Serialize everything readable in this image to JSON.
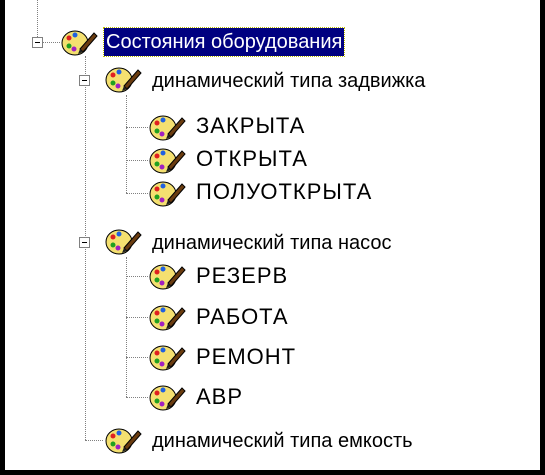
{
  "colors": {
    "selection_bg": "#000080",
    "selection_text": "#ffffff",
    "tree_line": "#808080",
    "frame": "#000000"
  },
  "tree": {
    "root": {
      "label": "Состояния оборудования",
      "icon": "palette-icon",
      "expanded": true,
      "selected": true
    },
    "groups": [
      {
        "label": "динамический типа задвижка",
        "icon": "palette-icon",
        "expanded": true,
        "children": [
          "ЗАКРЫТА",
          "ОТКРЫТА",
          "ПОЛУОТКРЫТА"
        ]
      },
      {
        "label": "динамический типа насос",
        "icon": "palette-icon",
        "expanded": true,
        "children": [
          "РЕЗЕРВ",
          "РАБОТА",
          "РЕМОНТ",
          "АВР"
        ]
      },
      {
        "label": "динамический типа емкость",
        "icon": "palette-icon",
        "expanded": false,
        "children": []
      }
    ]
  }
}
